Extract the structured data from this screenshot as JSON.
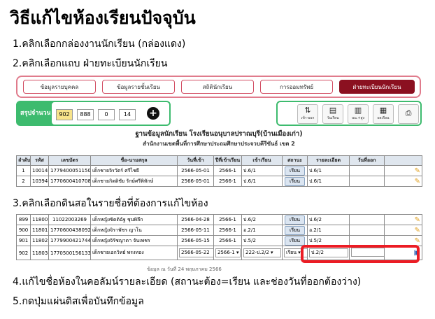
{
  "title": "วิธีแก้ไขห้องเรียนปัจจุบัน",
  "steps": [
    "1.คลิกเลือกกล่องงานนักเรียน (กล่องแดง)",
    "2.คลิกเลือกแถบ ฝ่ายทะเบียนนักเรียน",
    "3.คลิกเลือกดินสอในรายชื่อที่ต้องการแก้ไขห้อง",
    "4.แก้ไขชื่อห้องในคอลัมน์รายละเอียด (สถานะต้อง=เรียน และช่องวันที่ออกต้องว่าง)",
    "5.กดปุ่มแผ่นดิสเพื่อบันทึกข้อมูล"
  ],
  "tabs": [
    "ข้อมูลรายบุคคล",
    "ข้อมูลรายชั้นเรียน",
    "สถิตินักเรียน",
    "การออมทรัพย์",
    "ฝ่ายทะเบียนนักเรียน"
  ],
  "summary": {
    "label": "สรุปจำนวน",
    "counts": [
      "902",
      "888",
      "0",
      "14"
    ],
    "add": "+"
  },
  "toolbar": [
    {
      "icon": "exchange-icon",
      "glyph": "⇅",
      "label": "เข้า-ออก"
    },
    {
      "icon": "clipboard-icon",
      "glyph": "▤",
      "label": "วันเรียน"
    },
    {
      "icon": "chart-icon",
      "glyph": "▥",
      "label": "นน.+สูง"
    },
    {
      "icon": "bar-chart-icon",
      "glyph": "▦",
      "label": "ผลเรียน"
    },
    {
      "icon": "printer-icon",
      "glyph": "⎙",
      "label": ""
    }
  ],
  "heading": {
    "line1": "ฐานข้อมูลนักเรียน โรงเรียนอนุบาลปราณบุรี(บ้านเมืองเก่า)",
    "line2": "สำนักงานเขตพื้นที่การศึกษาประถมศึกษาประจวบคีรีขันธ์ เขต 2"
  },
  "table": {
    "columns": [
      "ลำดับ",
      "รหัส",
      "เลขบัตร",
      "ชื่อ-นามสกุล",
      "วันที่เข้า",
      "ปีที่เข้าเรียน",
      "เข้าเรียน",
      "สถานะ",
      "รายละเอียด",
      "วันที่ออก",
      ""
    ],
    "rows": [
      [
        "1",
        "10014",
        "1779400051150",
        "เด็กชายจิรวัตร์ ศรีไชยี",
        "2566-05-01",
        "2566-1",
        "ป.6/1",
        "เรียน",
        "ป.6/1",
        ""
      ],
      [
        "2",
        "10394",
        "1770600410708",
        "เด็กชายกิตติชัย รักษ์ศรีพิทักษ์",
        "2566-05-01",
        "2566-1",
        "ป.6/1",
        "เรียน",
        "ป.6/1",
        ""
      ]
    ]
  },
  "table2": {
    "rows": [
      [
        "899",
        "11800",
        "11022003269",
        "เด็กหญิงซิดดิฉัฐ ชุนพิลึก",
        "2566-04-28",
        "2566-1",
        "ป.6/2",
        "เรียน",
        "ป.6/2",
        ""
      ],
      [
        "900",
        "11801",
        "1770600438092",
        "เด็กหญิงจิราพัชร ญาโน",
        "2566-05-11",
        "2566-1",
        "อ.2/1",
        "เรียน",
        "อ.2/1",
        ""
      ],
      [
        "901",
        "11802",
        "1779900421744",
        "เด็กหญิงจิรัชญาดา จันเพชร",
        "2566-05-15",
        "2566-1",
        "ป.5/2",
        "เรียน",
        "ป.5/2",
        ""
      ]
    ],
    "edit_row": {
      "no": "902",
      "code": "11803",
      "id": "1770500156133",
      "name": "เด็กชายเอกวิทย์ พรงทอง",
      "date_in": "2566-05-22",
      "year": "2566-1",
      "class": "222-ป.2/2",
      "status": "เรียน",
      "detail": "ป.2/2",
      "date_out": ""
    },
    "footer_cut": "ข้อมูล ณ วันที่ 24 พฤษภาคม 2566"
  },
  "colors": {
    "accent_red": "#ec1c24",
    "active_tab": "#8b1020",
    "green": "#3dbb6e"
  }
}
